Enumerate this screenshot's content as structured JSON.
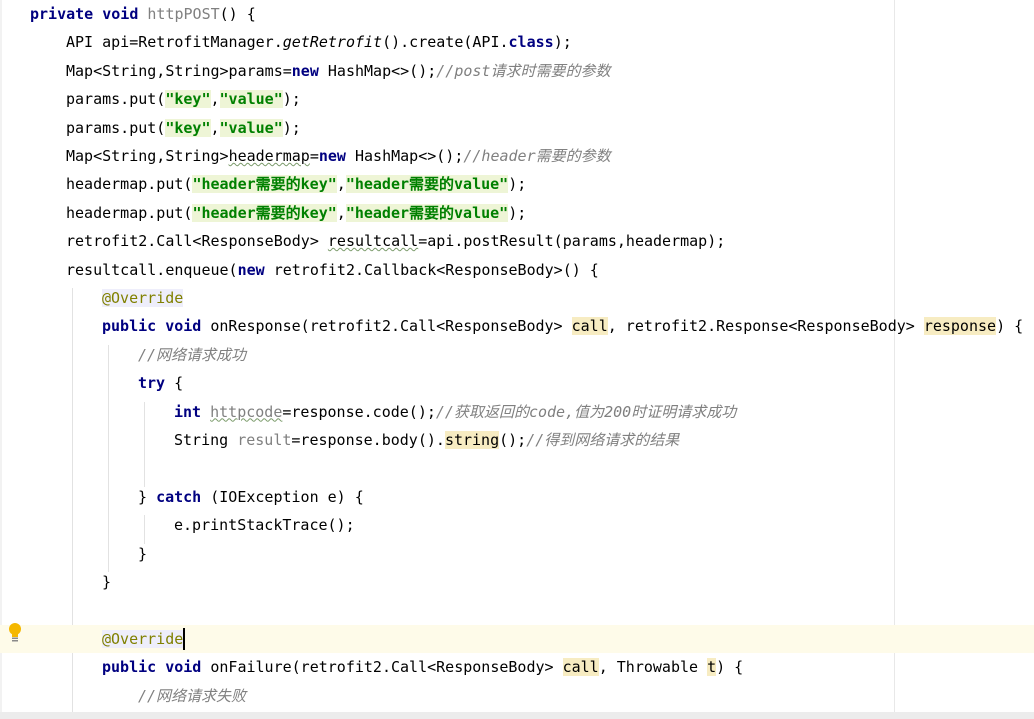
{
  "editor": {
    "lines": [
      {
        "indent": 0,
        "tokens": [
          {
            "t": "private void ",
            "c": "kw"
          },
          {
            "t": "httpPOST",
            "c": "unused"
          },
          {
            "t": "() {",
            "c": ""
          }
        ]
      },
      {
        "indent": 1,
        "tokens": [
          {
            "t": "API api=RetrofitManager.",
            "c": ""
          },
          {
            "t": "getRetrofit",
            "c": "fn-italic"
          },
          {
            "t": "().create(API.",
            "c": ""
          },
          {
            "t": "class",
            "c": "kw"
          },
          {
            "t": ");",
            "c": ""
          }
        ]
      },
      {
        "indent": 1,
        "tokens": [
          {
            "t": "Map<String,String>params=",
            "c": ""
          },
          {
            "t": "new ",
            "c": "kw"
          },
          {
            "t": "HashMap<>();",
            "c": ""
          },
          {
            "t": "//post请求时需要的参数",
            "c": "cmt"
          }
        ]
      },
      {
        "indent": 1,
        "tokens": [
          {
            "t": "params.put(",
            "c": ""
          },
          {
            "t": "\"key\"",
            "c": "str"
          },
          {
            "t": ",",
            "c": ""
          },
          {
            "t": "\"value\"",
            "c": "str"
          },
          {
            "t": ");",
            "c": ""
          }
        ]
      },
      {
        "indent": 1,
        "tokens": [
          {
            "t": "params.put(",
            "c": ""
          },
          {
            "t": "\"key\"",
            "c": "str"
          },
          {
            "t": ",",
            "c": ""
          },
          {
            "t": "\"value\"",
            "c": "str"
          },
          {
            "t": ");",
            "c": ""
          }
        ]
      },
      {
        "indent": 1,
        "tokens": [
          {
            "t": "Map<String,String>",
            "c": ""
          },
          {
            "t": "headermap",
            "c": "wavy"
          },
          {
            "t": "=",
            "c": ""
          },
          {
            "t": "new ",
            "c": "kw"
          },
          {
            "t": "HashMap<>();",
            "c": ""
          },
          {
            "t": "//header需要的参数",
            "c": "cmt"
          }
        ]
      },
      {
        "indent": 1,
        "tokens": [
          {
            "t": "headermap.put(",
            "c": ""
          },
          {
            "t": "\"header需要的key\"",
            "c": "str"
          },
          {
            "t": ",",
            "c": ""
          },
          {
            "t": "\"header需要的value\"",
            "c": "str"
          },
          {
            "t": ");",
            "c": ""
          }
        ]
      },
      {
        "indent": 1,
        "tokens": [
          {
            "t": "headermap.put(",
            "c": ""
          },
          {
            "t": "\"header需要的key\"",
            "c": "str"
          },
          {
            "t": ",",
            "c": ""
          },
          {
            "t": "\"header需要的value\"",
            "c": "str"
          },
          {
            "t": ");",
            "c": ""
          }
        ]
      },
      {
        "indent": 1,
        "tokens": [
          {
            "t": "retrofit2.Call<ResponseBody> ",
            "c": ""
          },
          {
            "t": "resultcall",
            "c": "wavy"
          },
          {
            "t": "=api.postResult(params,headermap);",
            "c": ""
          }
        ]
      },
      {
        "indent": 1,
        "tokens": [
          {
            "t": "resultcall.enqueue(",
            "c": ""
          },
          {
            "t": "new ",
            "c": "kw"
          },
          {
            "t": "retrofit2.Callback<ResponseBody>() {",
            "c": ""
          }
        ]
      },
      {
        "indent": 2,
        "tokens": [
          {
            "t": "@Override",
            "c": "ann"
          }
        ]
      },
      {
        "indent": 2,
        "tokens": [
          {
            "t": "public void ",
            "c": "kw"
          },
          {
            "t": "onResponse(retrofit2.Call<ResponseBody> ",
            "c": ""
          },
          {
            "t": "call",
            "c": "param-hl"
          },
          {
            "t": ", retrofit2.Response<ResponseBody> ",
            "c": ""
          },
          {
            "t": "response",
            "c": "param-hl"
          },
          {
            "t": ") {",
            "c": ""
          }
        ]
      },
      {
        "indent": 3,
        "tokens": [
          {
            "t": "//网络请求成功",
            "c": "cmt"
          }
        ]
      },
      {
        "indent": 3,
        "tokens": [
          {
            "t": "try ",
            "c": "kw"
          },
          {
            "t": "{",
            "c": ""
          }
        ]
      },
      {
        "indent": 4,
        "tokens": [
          {
            "t": "int ",
            "c": "kw"
          },
          {
            "t": "httpcode",
            "c": "unused wavy"
          },
          {
            "t": "=response.code();",
            "c": ""
          },
          {
            "t": "//获取返回的code,值为200时证明请求成功",
            "c": "cmt"
          }
        ]
      },
      {
        "indent": 4,
        "tokens": [
          {
            "t": "String ",
            "c": ""
          },
          {
            "t": "result",
            "c": "unused"
          },
          {
            "t": "=response.body().",
            "c": ""
          },
          {
            "t": "string",
            "c": "param-hl"
          },
          {
            "t": "();",
            "c": ""
          },
          {
            "t": "//得到网络请求的结果",
            "c": "cmt"
          }
        ]
      },
      {
        "indent": 4,
        "tokens": []
      },
      {
        "indent": 3,
        "tokens": [
          {
            "t": "} ",
            "c": ""
          },
          {
            "t": "catch ",
            "c": "kw"
          },
          {
            "t": "(IOException e) {",
            "c": ""
          }
        ]
      },
      {
        "indent": 4,
        "tokens": [
          {
            "t": "e.printStackTrace();",
            "c": ""
          }
        ]
      },
      {
        "indent": 3,
        "tokens": [
          {
            "t": "}",
            "c": ""
          }
        ]
      },
      {
        "indent": 2,
        "tokens": [
          {
            "t": "}",
            "c": ""
          }
        ]
      },
      {
        "indent": 2,
        "tokens": []
      },
      {
        "indent": 2,
        "current": true,
        "caret": true,
        "tokens": [
          {
            "t": "@Override",
            "c": "ann"
          }
        ]
      },
      {
        "indent": 2,
        "tokens": [
          {
            "t": "public void ",
            "c": "kw"
          },
          {
            "t": "onFailure(retrofit2.Call<ResponseBody> ",
            "c": ""
          },
          {
            "t": "call",
            "c": "param-hl"
          },
          {
            "t": ", Throwable ",
            "c": ""
          },
          {
            "t": "t",
            "c": "param-hl"
          },
          {
            "t": ") {",
            "c": ""
          }
        ]
      },
      {
        "indent": 3,
        "tokens": [
          {
            "t": "//网络请求失败",
            "c": "cmt"
          }
        ]
      }
    ]
  },
  "icons": {
    "intention": "lightbulb-icon"
  },
  "colors": {
    "keyword": "#000080",
    "string": "#008000",
    "comment": "#808080",
    "annotation": "#808000",
    "current_line": "#fefbe9"
  }
}
